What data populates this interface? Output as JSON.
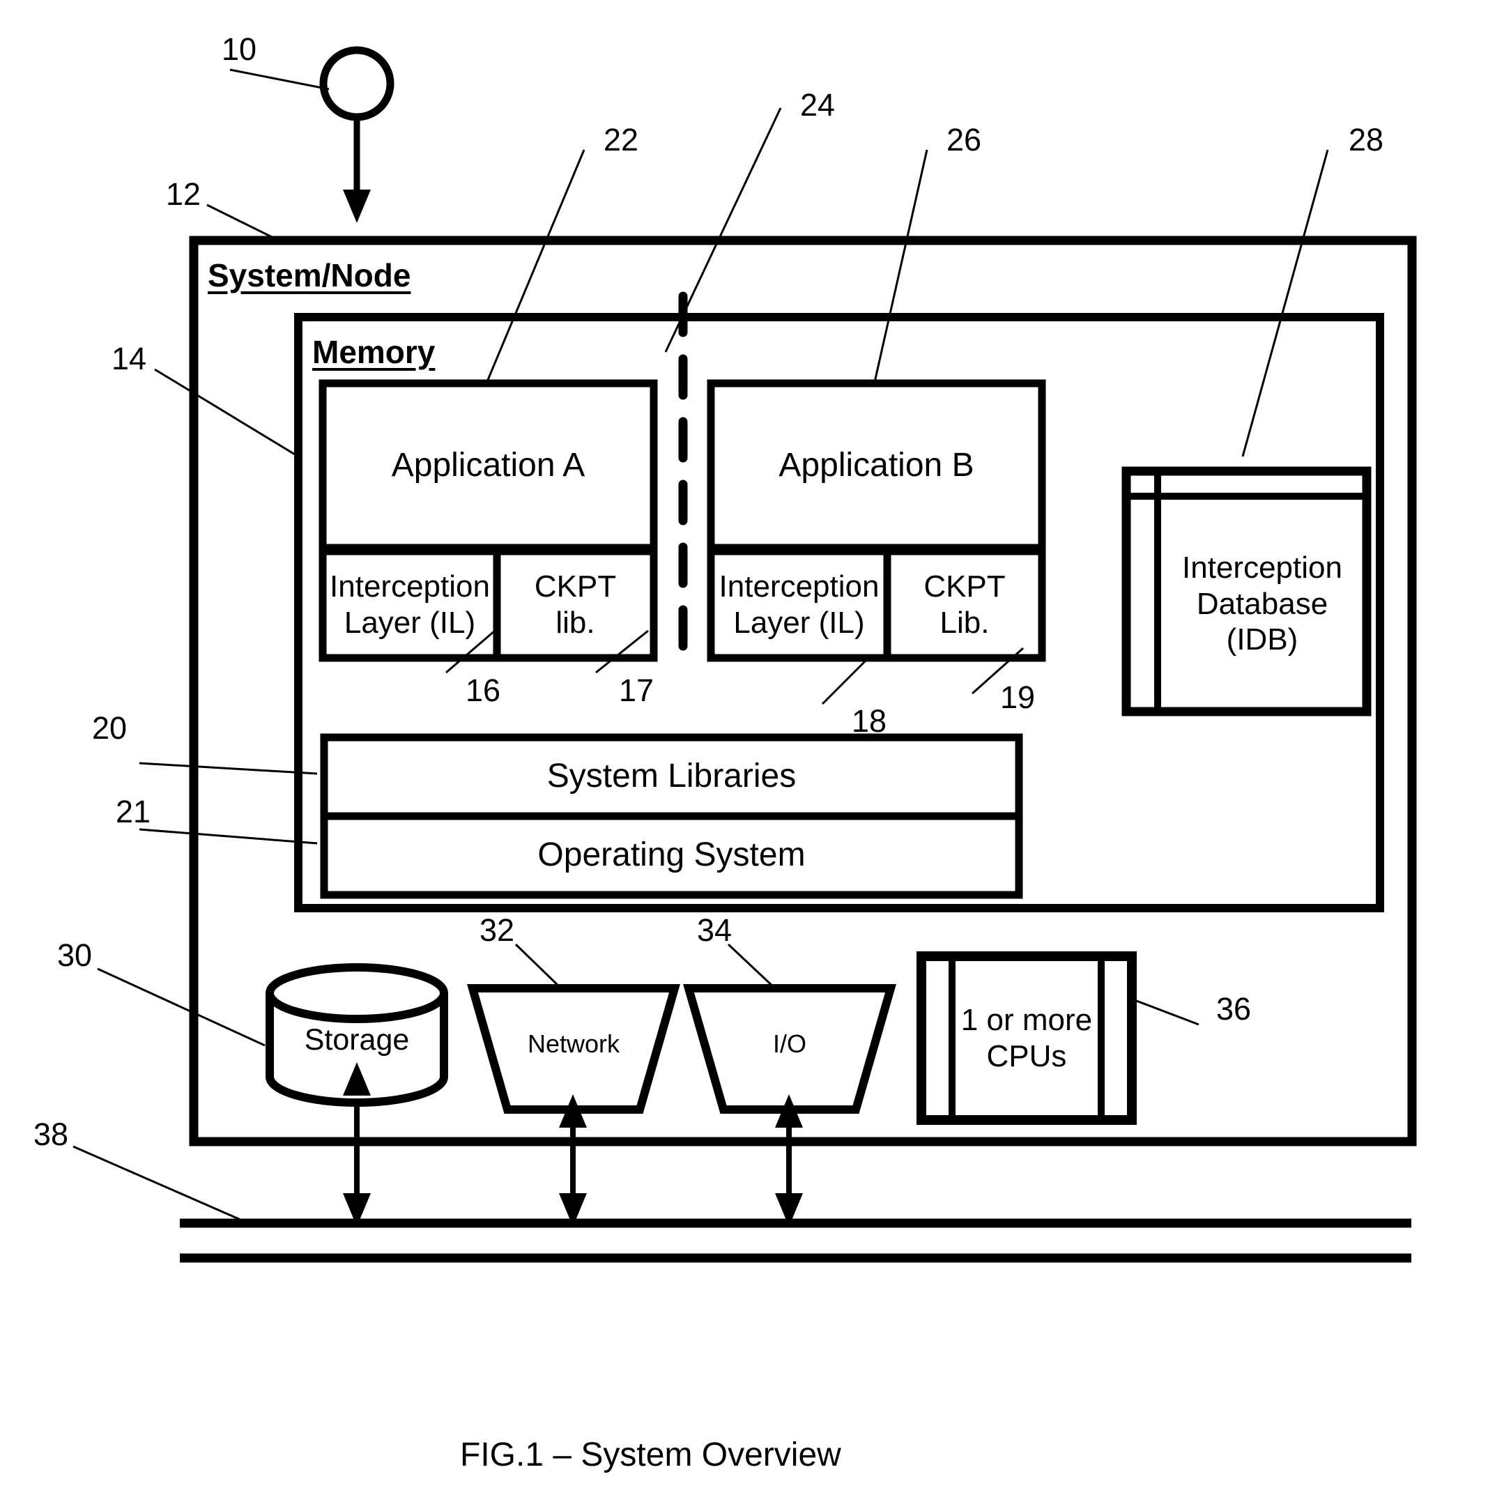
{
  "figure": {
    "caption": "FIG.1  – System Overview",
    "title": "System Overview"
  },
  "containers": {
    "system_node": {
      "label": "System/Node",
      "ref": "12"
    },
    "memory": {
      "label": "Memory",
      "ref": "14"
    }
  },
  "blocks": {
    "application_a": {
      "label": "Application A",
      "ref": "22"
    },
    "application_b": {
      "label": "Application B",
      "ref": "26"
    },
    "interception_layer_a": {
      "label": "Interception\nLayer (IL)",
      "ref": "16"
    },
    "ckpt_lib_a": {
      "label": "CKPT\nlib.",
      "ref": "17"
    },
    "interception_layer_b": {
      "label": "Interception\nLayer (IL)",
      "ref": "18"
    },
    "ckpt_lib_b": {
      "label": "CKPT\nLib.",
      "ref": "19"
    },
    "interception_database": {
      "label": "Interception\nDatabase\n(IDB)",
      "ref": "28"
    },
    "system_libraries": {
      "label": "System Libraries",
      "ref": "20"
    },
    "operating_system": {
      "label": "Operating System",
      "ref": "21"
    },
    "storage": {
      "label": "Storage",
      "ref": "30"
    },
    "network": {
      "label": "Network",
      "ref": "32"
    },
    "io": {
      "label": "I/O",
      "ref": "34"
    },
    "cpus": {
      "label": "1 or more\nCPUs",
      "ref": "36"
    },
    "bus": {
      "label": "",
      "ref": "38"
    },
    "process_marker": {
      "label": "",
      "ref": "10"
    },
    "isolation_boundary": {
      "label": "",
      "ref": "24"
    }
  },
  "reference_numerals": [
    {
      "id": "10",
      "text": "10"
    },
    {
      "id": "12",
      "text": "12"
    },
    {
      "id": "14",
      "text": "14"
    },
    {
      "id": "16",
      "text": "16"
    },
    {
      "id": "17",
      "text": "17"
    },
    {
      "id": "18",
      "text": "18"
    },
    {
      "id": "19",
      "text": "19"
    },
    {
      "id": "20",
      "text": "20"
    },
    {
      "id": "21",
      "text": "21"
    },
    {
      "id": "22",
      "text": "22"
    },
    {
      "id": "24",
      "text": "24"
    },
    {
      "id": "26",
      "text": "26"
    },
    {
      "id": "28",
      "text": "28"
    },
    {
      "id": "30",
      "text": "30"
    },
    {
      "id": "32",
      "text": "32"
    },
    {
      "id": "34",
      "text": "34"
    },
    {
      "id": "36",
      "text": "36"
    },
    {
      "id": "38",
      "text": "38"
    }
  ],
  "colors": {
    "ink": "#000000",
    "paper": "#ffffff"
  }
}
